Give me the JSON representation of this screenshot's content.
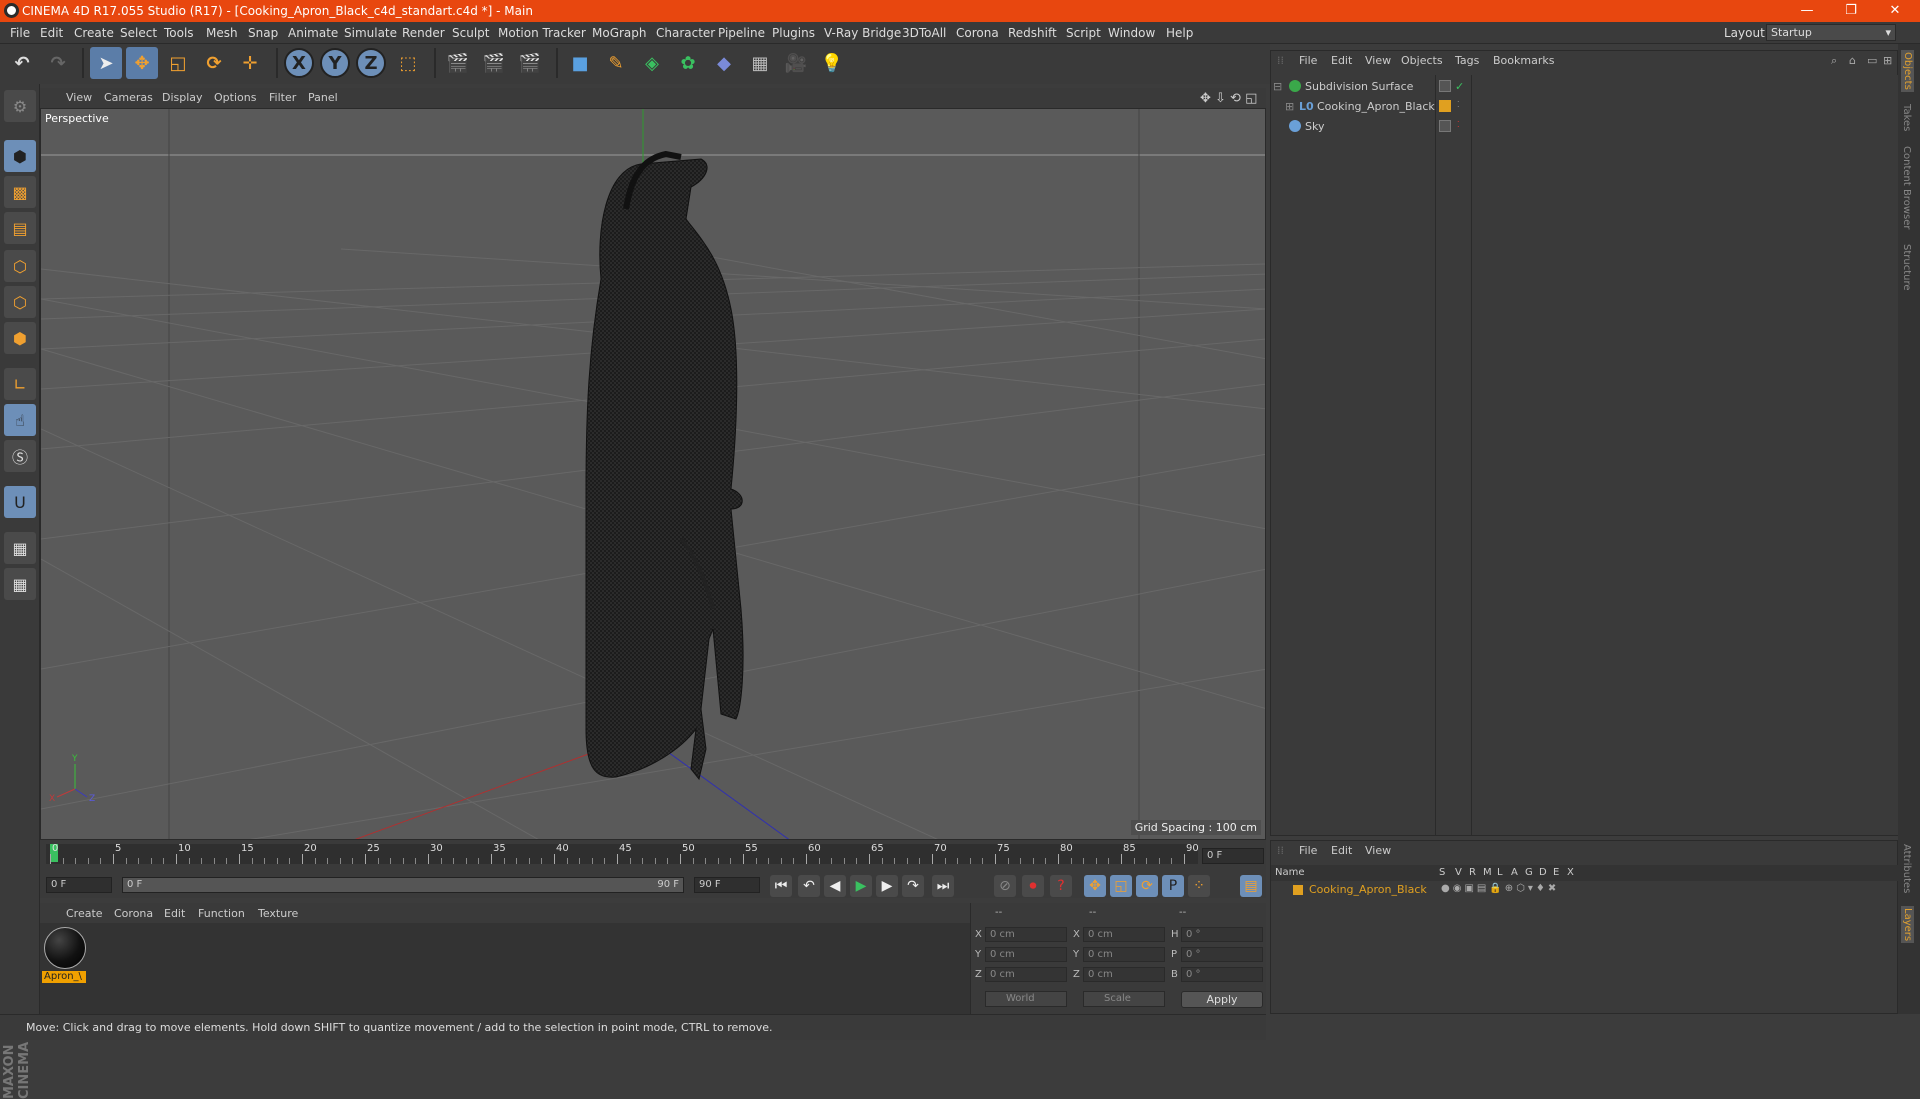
{
  "window": {
    "title": "CINEMA 4D R17.055 Studio (R17) - [Cooking_Apron_Black_c4d_standart.c4d *] - Main",
    "minimize": "—",
    "restore": "❐",
    "close": "✕"
  },
  "menu": {
    "items": [
      "File",
      "Edit",
      "Create",
      "Select",
      "Tools",
      "Mesh",
      "Snap",
      "Animate",
      "Simulate",
      "Render",
      "Sculpt",
      "Motion Tracker",
      "MoGraph",
      "Character",
      "Pipeline",
      "Plugins",
      "V-Ray Bridge",
      "3DToAll",
      "Corona",
      "Redshift",
      "Script",
      "Window",
      "Help"
    ],
    "layout_label": "Layout:",
    "layout_value": "Startup"
  },
  "toolbar": {
    "axis_x": "X",
    "axis_y": "Y",
    "axis_z": "Z"
  },
  "viewport": {
    "menu": [
      "View",
      "Cameras",
      "Display",
      "Options",
      "Filter",
      "Panel"
    ],
    "label": "Perspective",
    "grid_spacing": "Grid Spacing : 100 cm",
    "axis_labels": {
      "x": "X",
      "y": "Y",
      "z": "Z"
    }
  },
  "timeline": {
    "ticks": [
      "0",
      "5",
      "10",
      "15",
      "20",
      "25",
      "30",
      "35",
      "40",
      "45",
      "50",
      "55",
      "60",
      "65",
      "70",
      "75",
      "80",
      "85",
      "90"
    ],
    "current_frame": "0 F",
    "start_frame": "0 F",
    "range_start": "0 F",
    "range_end": "90 F",
    "end_frame": "90 F"
  },
  "materials": {
    "menu": [
      "Create",
      "Corona",
      "Edit",
      "Function",
      "Texture"
    ],
    "items": [
      {
        "name": "Apron_\\",
        "color": "#111111"
      }
    ]
  },
  "coordinates": {
    "header": [
      "--",
      "--",
      "--"
    ],
    "rows": [
      {
        "l1": "X",
        "v1": "0 cm",
        "l2": "X",
        "v2": "0 cm",
        "l3": "H",
        "v3": "0 °"
      },
      {
        "l1": "Y",
        "v1": "0 cm",
        "l2": "Y",
        "v2": "0 cm",
        "l3": "P",
        "v3": "0 °"
      },
      {
        "l1": "Z",
        "v1": "0 cm",
        "l2": "Z",
        "v2": "0 cm",
        "l3": "B",
        "v3": "0 °"
      }
    ],
    "space": "World",
    "mode": "Scale",
    "apply": "Apply"
  },
  "status": {
    "text": "Move: Click and drag to move elements. Hold down SHIFT to quantize movement / add to the selection in point mode, CTRL to remove."
  },
  "object_manager": {
    "menu": [
      "File",
      "Edit",
      "View",
      "Objects",
      "Tags",
      "Bookmarks"
    ],
    "objects": [
      {
        "name": "Subdivision Surface",
        "icon_color": "#3aa84a"
      },
      {
        "name": "Cooking_Apron_Black",
        "icon_color": "#6aa0d8"
      },
      {
        "name": "Sky",
        "icon_color": "#6aa0d8"
      }
    ]
  },
  "layer_manager": {
    "menu": [
      "File",
      "Edit",
      "View"
    ],
    "columns": [
      "Name",
      "S",
      "V",
      "R",
      "M",
      "L",
      "A",
      "G",
      "D",
      "E",
      "X"
    ],
    "layers": [
      {
        "name": "Cooking_Apron_Black",
        "color": "#e0a020"
      }
    ]
  },
  "right_tabs": [
    "Objects",
    "Takes",
    "Content Browser",
    "Structure",
    "Attributes",
    "Layers"
  ],
  "brand": "MAXON CINEMA 4D",
  "colors": {
    "accent": "#e8470f",
    "active_blue": "#5b7da8",
    "layer_orange": "#e0a020"
  }
}
